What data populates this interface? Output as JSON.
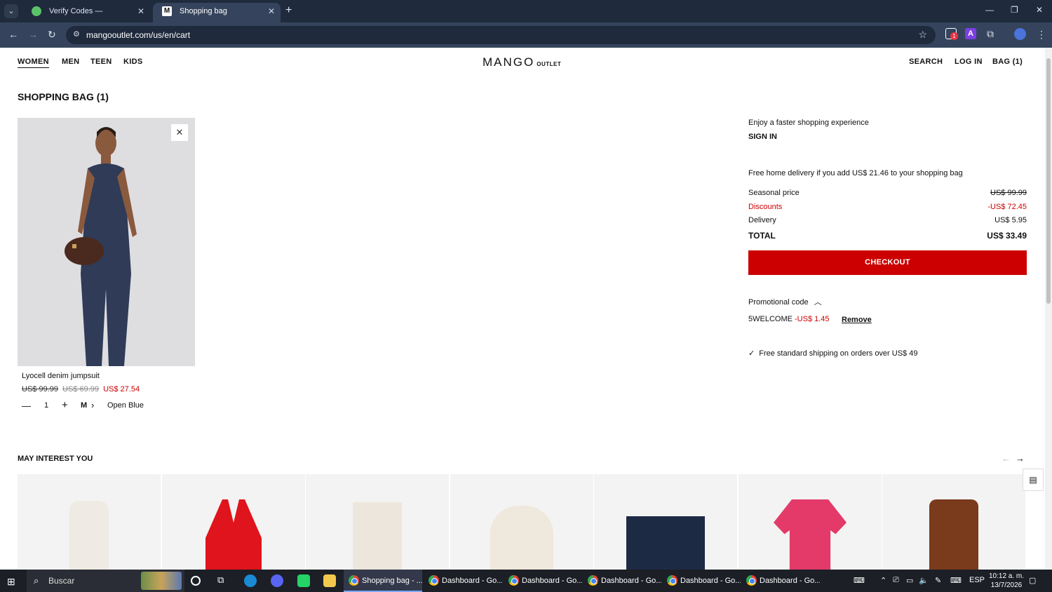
{
  "browser": {
    "tabs": [
      {
        "label": "Verify Codes — SimplyCodes",
        "active": false
      },
      {
        "label": "Shopping bag",
        "active": true
      }
    ],
    "url": "mangooutlet.com/us/en/cart",
    "extension_badge": "1"
  },
  "site": {
    "nav": [
      "WOMEN",
      "MEN",
      "TEEN",
      "KIDS"
    ],
    "logo": "MANGO",
    "logo_sub": "OUTLET",
    "right_nav": {
      "search": "SEARCH",
      "login": "LOG IN",
      "bag": "BAG (1)"
    }
  },
  "cart": {
    "title": "SHOPPING BAG (1)",
    "item": {
      "name": "Lyocell denim jumpsuit",
      "price_original": "US$ 99.99",
      "price_sale": "US$ 69.99",
      "price_final": "US$ 27.54",
      "quantity": "1",
      "size": "M",
      "color": "Open Blue"
    }
  },
  "summary": {
    "faster": "Enjoy a faster shopping experience",
    "sign_in": "SIGN IN",
    "free_delivery_msg": "Free home delivery if you add US$ 21.46 to your shopping bag",
    "seasonal_label": "Seasonal price",
    "seasonal_value": "US$ 99.99",
    "discounts_label": "Discounts",
    "discounts_value": "-US$ 72.45",
    "delivery_label": "Delivery",
    "delivery_value": "US$ 5.95",
    "total_label": "TOTAL",
    "total_value": "US$ 33.49",
    "checkout": "CHECKOUT",
    "promo_label": "Promotional code",
    "promo_code": "5WELCOME",
    "promo_discount": "-US$ 1.45",
    "promo_remove": "Remove",
    "shipping_note": "Free standard shipping on orders over US$ 49"
  },
  "recommendations": {
    "title": "MAY INTEREST YOU",
    "items": [
      {
        "color": "#efebe4"
      },
      {
        "color": "#e0141c"
      },
      {
        "color": "#ece6dc"
      },
      {
        "color": "#efe8dc"
      },
      {
        "color": "#1d2a44"
      },
      {
        "color": "#e33a6a"
      },
      {
        "color": "#7a3a1c"
      }
    ]
  },
  "taskbar": {
    "search_placeholder": "Buscar",
    "apps": [
      {
        "label": "Shopping bag - ...",
        "active": true
      },
      {
        "label": "Dashboard - Go...",
        "active": false
      },
      {
        "label": "Dashboard - Go...",
        "active": false
      },
      {
        "label": "Dashboard - Go...",
        "active": false
      },
      {
        "label": "Dashboard - Go...",
        "active": false
      },
      {
        "label": "Dashboard - Go...",
        "active": false
      }
    ],
    "language": "ESP",
    "time": "10:12 a. m.",
    "date": "13/7/2026"
  },
  "colors": {
    "accent_red": "#cc0000",
    "chrome_dark": "#1f2a3c",
    "chrome_mid": "#35445c"
  }
}
